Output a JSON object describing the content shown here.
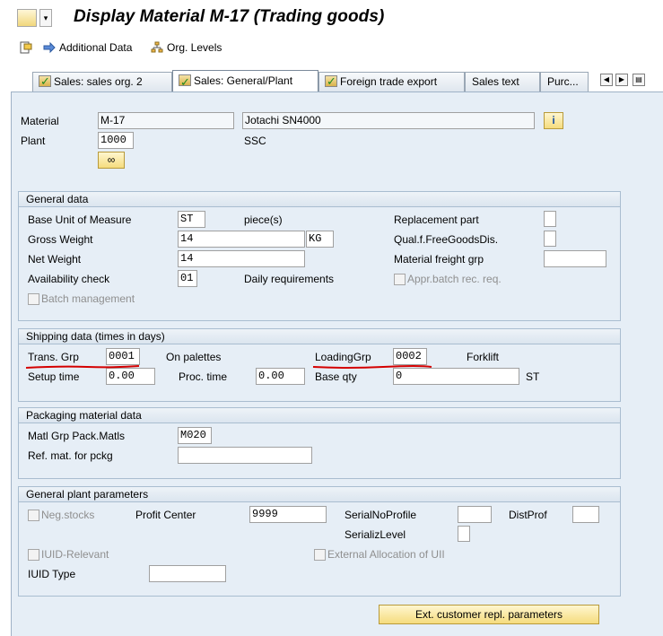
{
  "window": {
    "title": "Display Material M-17 (Trading goods)"
  },
  "toolbar": {
    "additional_data": "Additional Data",
    "org_levels": "Org. Levels"
  },
  "tabs": [
    {
      "label": "Sales: sales org. 2",
      "checked": true
    },
    {
      "label": "Sales: General/Plant",
      "checked": true,
      "active": true
    },
    {
      "label": "Foreign trade export",
      "checked": true
    },
    {
      "label": "Sales text",
      "checked": false
    },
    {
      "label": "Purc...",
      "checked": false
    }
  ],
  "header": {
    "material_label": "Material",
    "material_value": "M-17",
    "material_desc": "Jotachi SN4000",
    "plant_label": "Plant",
    "plant_value": "1000",
    "plant_desc": "SSC"
  },
  "general_data": {
    "title": "General data",
    "base_uom_label": "Base Unit of Measure",
    "base_uom": "ST",
    "base_uom_text": "piece(s)",
    "replacement_part_label": "Replacement part",
    "gross_weight_label": "Gross Weight",
    "gross_weight": "14",
    "weight_unit": "KG",
    "qual_free_goods_label": "Qual.f.FreeGoodsDis.",
    "net_weight_label": "Net Weight",
    "net_weight": "14",
    "material_freight_label": "Material freight grp",
    "availability_label": "Availability check",
    "availability": "01",
    "availability_text": "Daily requirements",
    "appr_batch_label": "Appr.batch rec. req.",
    "batch_mgmt_label": "Batch management"
  },
  "shipping": {
    "title": "Shipping data (times in days)",
    "trans_grp_label": "Trans. Grp",
    "trans_grp": "0001",
    "trans_grp_text": "On palettes",
    "loading_grp_label": "LoadingGrp",
    "loading_grp": "0002",
    "loading_grp_text": "Forklift",
    "setup_time_label": "Setup time",
    "setup_time": "0.00",
    "proc_time_label": "Proc. time",
    "proc_time": "0.00",
    "base_qty_label": "Base qty",
    "base_qty": "0",
    "base_qty_unit": "ST"
  },
  "packaging": {
    "title": "Packaging material data",
    "matl_grp_label": "Matl Grp Pack.Matls",
    "matl_grp": "M020",
    "ref_mat_label": "Ref. mat. for pckg"
  },
  "plant_params": {
    "title": "General plant parameters",
    "neg_stocks_label": "Neg.stocks",
    "profit_center_label": "Profit Center",
    "profit_center": "9999",
    "serial_profile_label": "SerialNoProfile",
    "dist_prof_label": "DistProf",
    "serializ_level_label": "SerializLevel",
    "iuid_relevant_label": "IUID-Relevant",
    "ext_alloc_label": "External Allocation of UII",
    "iuid_type_label": "IUID Type"
  },
  "footer": {
    "ext_customer_btn": "Ext. customer repl. parameters"
  },
  "colors": {
    "annotation_red": "#d40000",
    "panel_bg": "#e6eef6",
    "button_yellow": "#f5dc7e"
  }
}
